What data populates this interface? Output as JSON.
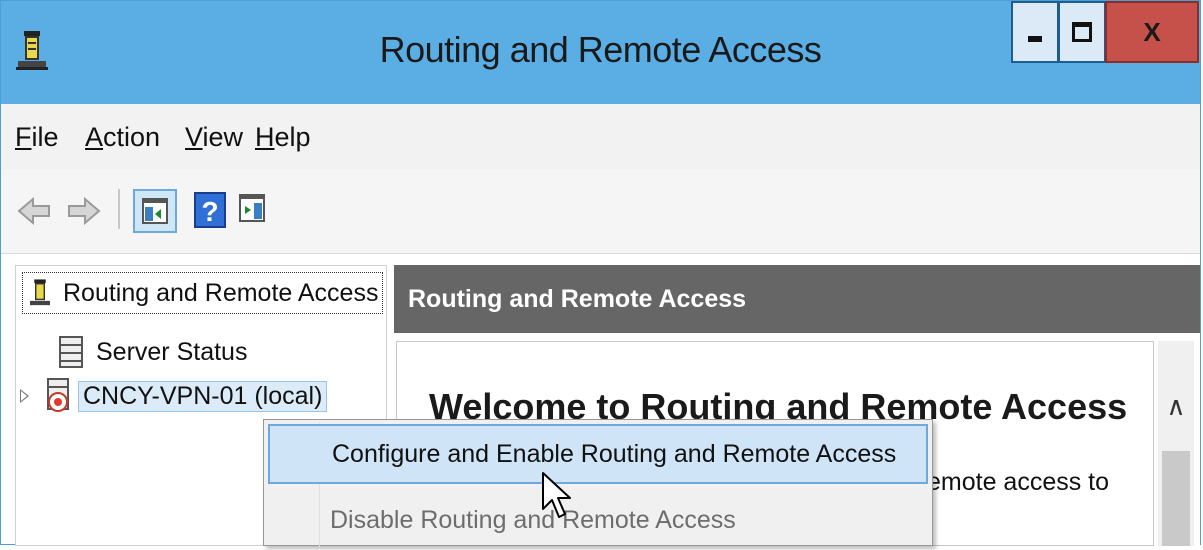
{
  "window": {
    "title": "Routing and Remote Access",
    "controls": {
      "minimize": "minimize",
      "maximize": "maximize",
      "close": "X"
    }
  },
  "menu": {
    "items": [
      "File",
      "Action",
      "View",
      "Help"
    ]
  },
  "toolbar": {
    "icons": [
      "back-arrow-icon",
      "forward-arrow-icon",
      "show-hide-console-tree-icon",
      "help-icon",
      "show-hide-action-pane-icon"
    ]
  },
  "tree": {
    "root": "Routing and Remote Access",
    "status": "Server Status",
    "server": "CNCY-VPN-01 (local)"
  },
  "right_pane": {
    "header": "Routing and Remote Access",
    "welcome": "Welcome to Routing and Remote Access",
    "desc_fragment": "emote access to"
  },
  "context_menu": {
    "items": [
      {
        "label": "Configure and Enable Routing and Remote Access",
        "state": "highlighted"
      },
      {
        "label": "Disable Routing and Remote Access",
        "state": "disabled"
      }
    ]
  },
  "colors": {
    "titlebar": "#5aaee4",
    "close_button": "#c6514a",
    "pane_header": "#666666",
    "menu_highlight": "#cfe4f7"
  }
}
